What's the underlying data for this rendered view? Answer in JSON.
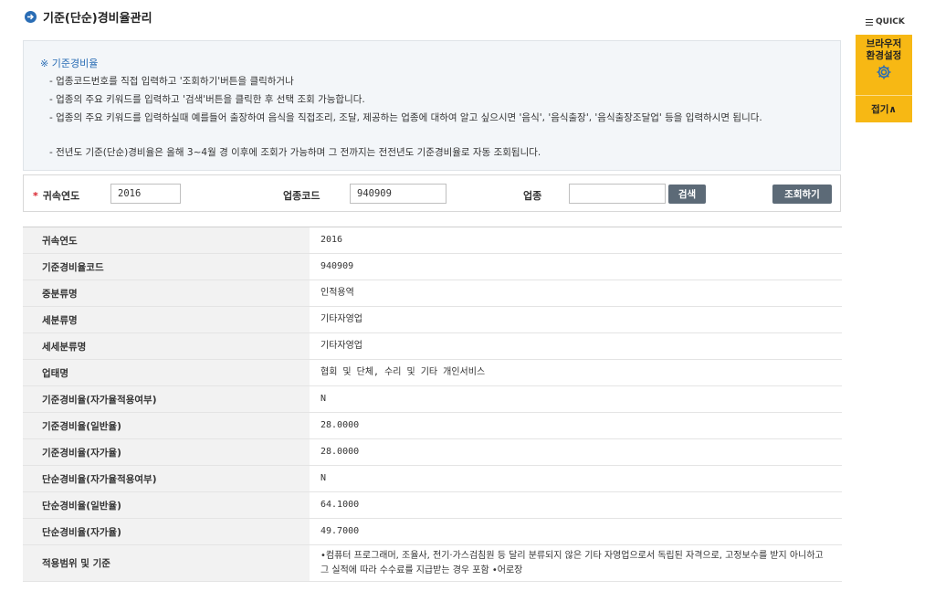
{
  "page": {
    "title": "기준(단순)경비율관리"
  },
  "info": {
    "heading": "※ 기준경비율",
    "lines": [
      "- 업종코드번호를 직접 입력하고 '조회하기'버튼을 클릭하거나",
      "- 업종의 주요 키워드를 입력하고 '검색'버튼을 클릭한 후 선택 조회 가능합니다.",
      "- 업종의 주요 키워드를 입력하실때 예를들어 출장하여 음식을 직접조리, 조달, 제공하는 업종에 대하여 알고 싶으시면 '음식', '음식출장', '음식출장조달업' 등을 입력하시면 됩니다.",
      "- 전년도 기준(단순)경비율은 올해 3~4월 경 이후에 조회가 가능하며 그 전까지는 전전년도 기준경비율로 자동 조회됩니다."
    ]
  },
  "search": {
    "year_label": "귀속연도",
    "year_value": "2016",
    "code_label": "업종코드",
    "code_value": "940909",
    "industry_label": "업종",
    "industry_value": "",
    "search_button": "검색",
    "query_button": "조회하기"
  },
  "result": {
    "rows": [
      {
        "label": "귀속연도",
        "value": "2016"
      },
      {
        "label": "기준경비율코드",
        "value": "940909"
      },
      {
        "label": "중분류명",
        "value": "인적용역"
      },
      {
        "label": "세분류명",
        "value": "기타자영업"
      },
      {
        "label": "세세분류명",
        "value": "기타자영업"
      },
      {
        "label": "업태명",
        "value": "협회 및 단체, 수리 및 기타 개인서비스"
      },
      {
        "label": "기준경비율(자가율적용여부)",
        "value": "N"
      },
      {
        "label": "기준경비율(일반율)",
        "value": "28.0000"
      },
      {
        "label": "기준경비율(자가율)",
        "value": "28.0000"
      },
      {
        "label": "단순경비율(자가율적용여부)",
        "value": "N"
      },
      {
        "label": "단순경비율(일반율)",
        "value": "64.1000"
      },
      {
        "label": "단순경비율(자가율)",
        "value": "49.7000"
      },
      {
        "label": "적용범위 및 기준",
        "value": "•컴퓨터 프로그래머, 조율사, 전기·가스검침원 등 달리 분류되지 않은 기타 자영업으로서 독립된 자격으로, 고정보수를 받지 아니하고 그 실적에 따라 수수료를 지급받는 경우 포함 •어로장"
      }
    ]
  },
  "quick": {
    "label": "QUICK",
    "setting_line1": "브라우저",
    "setting_line2": "환경설정",
    "fold": "접기∧"
  },
  "colors": {
    "accent": "#2a6db5",
    "quick_bg": "#f7b814",
    "button_bg": "#5c6a77",
    "required": "#d9232d"
  }
}
